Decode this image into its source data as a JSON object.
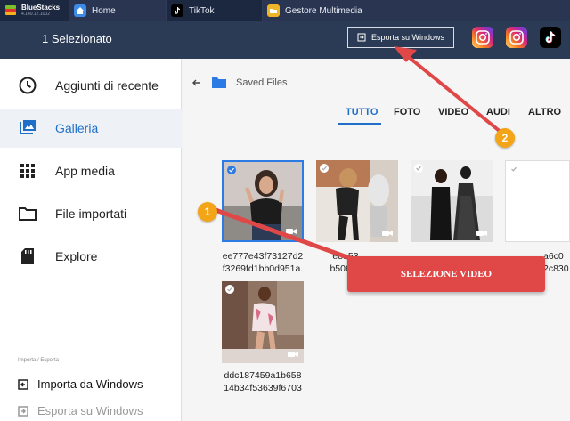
{
  "tabbar": {
    "brand_name": "BlueStacks",
    "brand_version": "4.140.12.1002",
    "tabs": [
      {
        "label": "Home",
        "icon": "home-icon"
      },
      {
        "label": "TikTok",
        "icon": "tiktok-icon"
      },
      {
        "label": "Gestore Multimedia",
        "icon": "folder-icon"
      }
    ]
  },
  "header": {
    "title": "1 Selezionato",
    "export_label": "Esporta su Windows"
  },
  "sidebar": {
    "items": [
      {
        "label": "Aggiunti di recente",
        "icon": "clock-icon"
      },
      {
        "label": "Galleria",
        "icon": "gallery-icon",
        "active": true
      },
      {
        "label": "App media",
        "icon": "grid-icon"
      },
      {
        "label": "File importati",
        "icon": "folder-icon"
      },
      {
        "label": "Explore",
        "icon": "sd-card-icon"
      }
    ],
    "section_label": "Importa / Esporta",
    "import_label": "Importa da Windows",
    "export_label": "Esporta su Windows"
  },
  "main": {
    "breadcrumb": "Saved Files",
    "filter_tabs": [
      "TUTTO",
      "FOTO",
      "VIDEO",
      "AUDI",
      "ALTRO"
    ],
    "active_tab": "TUTTO",
    "files": [
      {
        "caption_1": "ee777e43f73127d2",
        "caption_2": "f3269fd1bb0d951a.",
        "selected": true
      },
      {
        "caption_1": "e8a53",
        "caption_2": "b506e5",
        "selected": false
      },
      {
        "caption_1": "",
        "caption_2": "",
        "selected": false
      },
      {
        "caption_1": "a6c0",
        "caption_2": "2c830",
        "selected": false
      },
      {
        "caption_1": "ddc187459a1b658",
        "caption_2": "14b34f53639f6703",
        "selected": false
      }
    ]
  },
  "annotations": {
    "badge_1": "1",
    "badge_2": "2",
    "callout": "SELEZIONE VIDEO"
  },
  "colors": {
    "tabbar": "#1c2740",
    "header": "#2b3a55",
    "accent": "#1f6fc9",
    "annotation_red": "#e04848",
    "badge_orange": "#f4a417"
  }
}
